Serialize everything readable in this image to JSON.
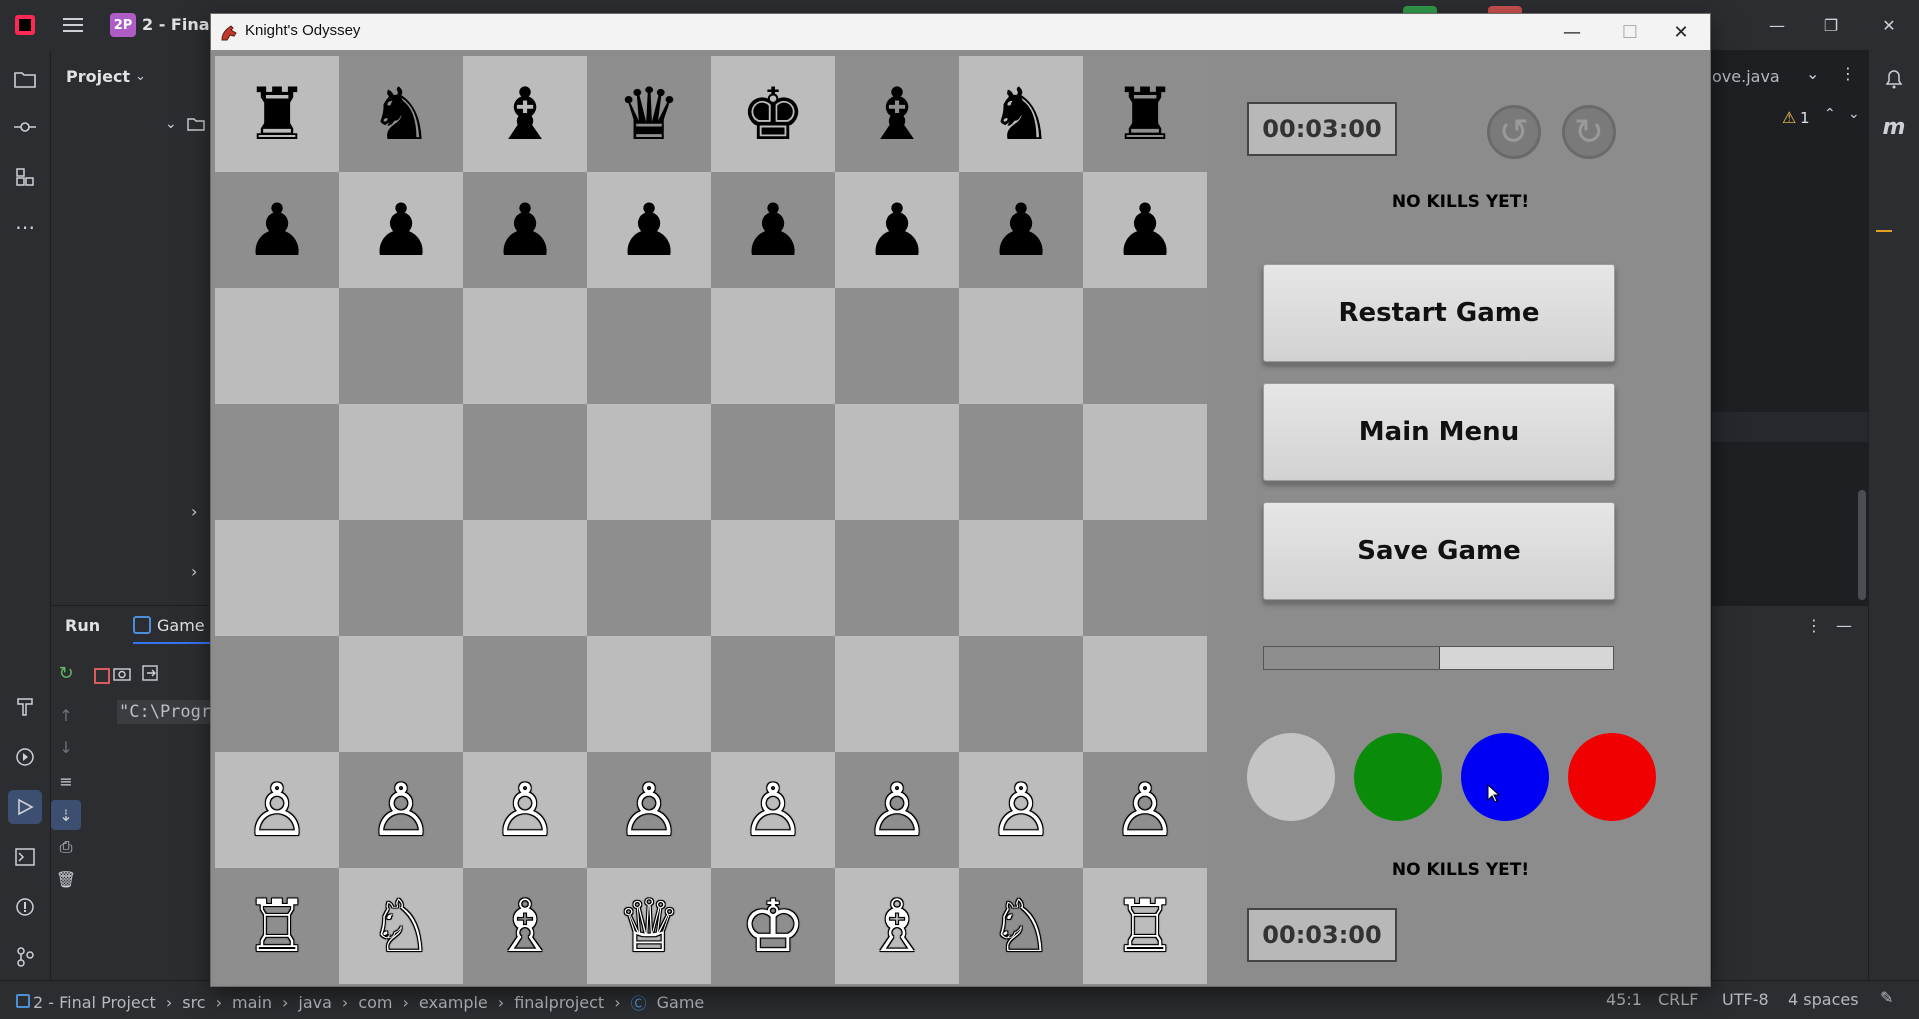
{
  "ide": {
    "project_badge": "2P",
    "project_name": "2 - Final",
    "project_label": "Project",
    "run_tab": "Run",
    "game_tab": "Game",
    "console_text": "\"C:\\Progr",
    "editor_tab": "ove.java",
    "warning_count": "1",
    "status": {
      "breadcrumbs": [
        "2 - Final Project",
        "src",
        "main",
        "java",
        "com",
        "example",
        "finalproject",
        "Game"
      ],
      "position": "45:1",
      "line_ending": "CRLF",
      "encoding": "UTF-8",
      "indent": "4 spaces"
    }
  },
  "game": {
    "window_title": "Knight's Odyssey",
    "board": {
      "rows": [
        [
          "♜",
          "♞",
          "♝",
          "♛",
          "♚",
          "♝",
          "♞",
          "♜"
        ],
        [
          "♟",
          "♟",
          "♟",
          "♟",
          "♟",
          "♟",
          "♟",
          "♟"
        ],
        [
          "",
          "",
          "",
          "",
          "",
          "",
          "",
          ""
        ],
        [
          "",
          "",
          "",
          "",
          "",
          "",
          "",
          ""
        ],
        [
          "",
          "",
          "",
          "",
          "",
          "",
          "",
          ""
        ],
        [
          "",
          "",
          "",
          "",
          "",
          "",
          "",
          ""
        ],
        [
          "♙",
          "♙",
          "♙",
          "♙",
          "♙",
          "♙",
          "♙",
          "♙"
        ],
        [
          "♖",
          "♘",
          "♗",
          "♕",
          "♔",
          "♗",
          "♘",
          "♖"
        ]
      ],
      "colors": [
        "black",
        "black",
        "",
        "",
        "",
        "",
        "white",
        "white"
      ]
    },
    "top_timer": "00:03:00",
    "top_kills": "NO KILLS YET!",
    "buttons": {
      "restart": "Restart Game",
      "main_menu": "Main Menu",
      "save": "Save Game"
    },
    "progress_fraction": 0.5,
    "swatches": [
      "#c4c4c4",
      "#0a8c0a",
      "#0000f5",
      "#f00000"
    ],
    "bottom_kills": "NO KILLS YET!",
    "bottom_timer": "00:03:00"
  }
}
